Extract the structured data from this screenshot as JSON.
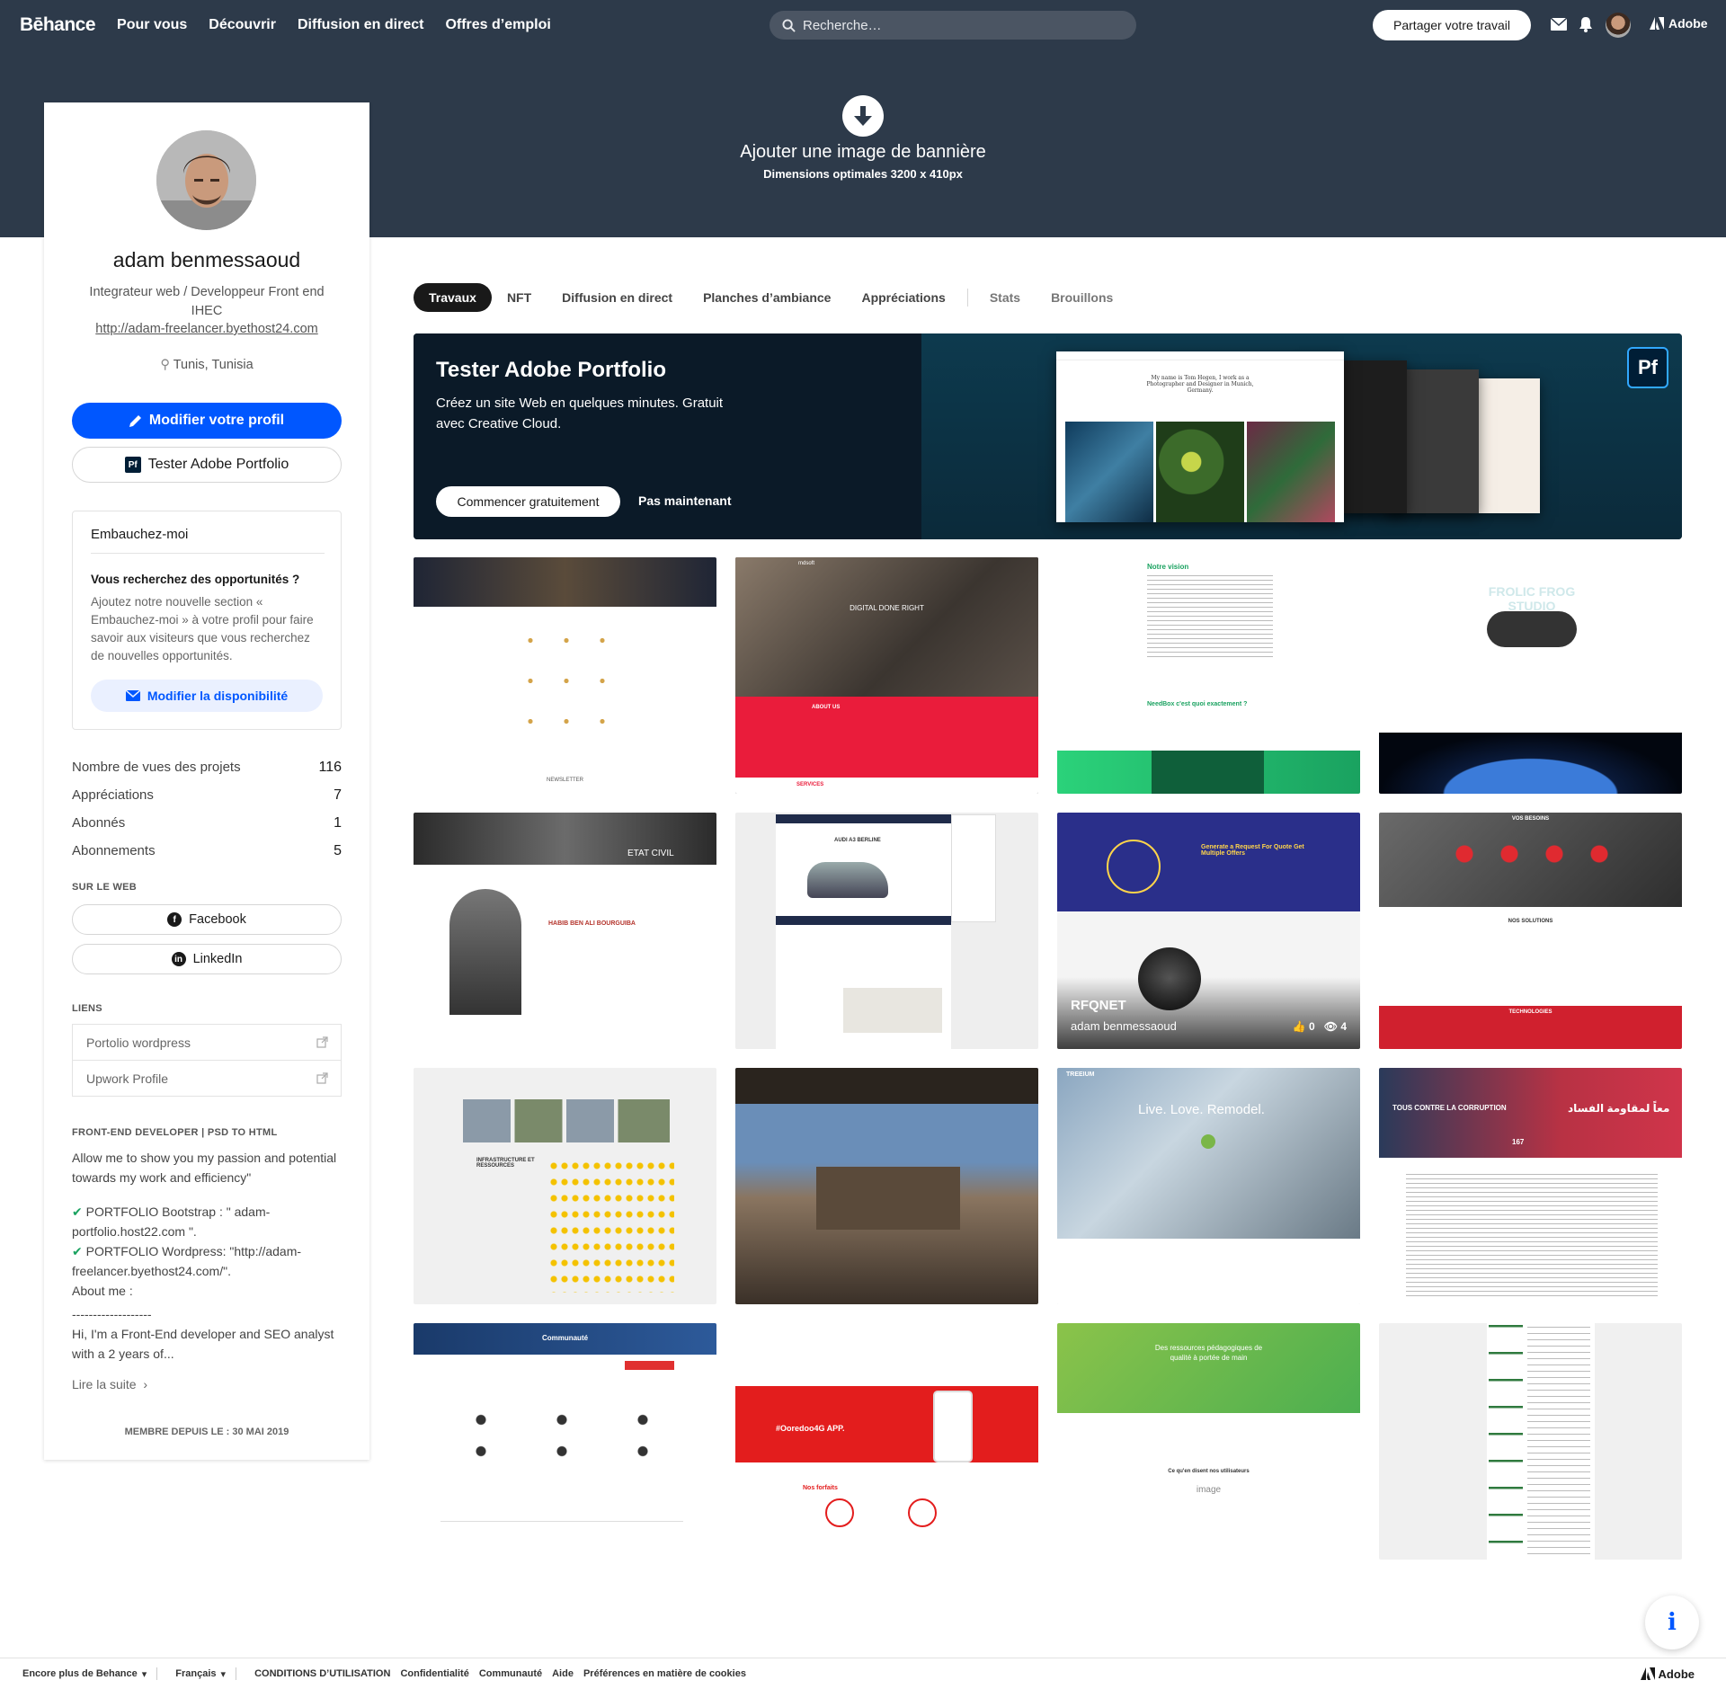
{
  "nav": {
    "logo": "Bēhance",
    "links": [
      "Pour vous",
      "Découvrir",
      "Diffusion en direct",
      "Offres d’emploi"
    ],
    "search_placeholder": "Recherche…",
    "share_label": "Partager votre travail",
    "adobe_label": "Adobe"
  },
  "banner": {
    "title": "Ajouter une image de bannière",
    "subtitle": "Dimensions optimales 3200 x 410px"
  },
  "profile": {
    "name": "adam benmessaoud",
    "title": "Integrateur web / Developpeur Front end IHEC",
    "website": "http://adam-freelancer.byethost24.com",
    "location": "Tunis, Tunisia",
    "edit_label": "Modifier votre profil",
    "portfolio_label": "Tester Adobe Portfolio",
    "hire": {
      "title": "Embauchez-moi",
      "question": "Vous recherchez des opportunités ?",
      "description": "Ajoutez notre nouvelle section « Embauchez-moi » à votre profil pour faire savoir aux visiteurs que vous recherchez de nouvelles opportunités.",
      "button": "Modifier la disponibilité"
    },
    "stats": [
      {
        "label": "Nombre de vues des projets",
        "value": "116"
      },
      {
        "label": "Appréciations",
        "value": "7"
      },
      {
        "label": "Abonnés",
        "value": "1"
      },
      {
        "label": "Abonnements",
        "value": "5"
      }
    ],
    "web_label": "SUR LE WEB",
    "social": [
      "Facebook",
      "LinkedIn"
    ],
    "links_label": "LIENS",
    "links": [
      "Portolio wordpress",
      "Upwork Profile"
    ],
    "about_label": "FRONT-END DEVELOPER | PSD TO HTML",
    "about_intro": "Allow me to show you my passion and potential towards my work and efficiency\"",
    "about_p1": "PORTFOLIO Bootstrap : \" adam-portfolio.host22.com \".",
    "about_p2": "PORTFOLIO Wordpress: \"http://adam-freelancer.byethost24.com/\".",
    "about_me": "About me :",
    "about_dash": "-------------------",
    "about_bio": "Hi, I'm a Front-End developer and SEO analyst with a 2 years of...",
    "read_more": "Lire la suite",
    "member_since": "MEMBRE DEPUIS LE : 30 MAI 2019"
  },
  "tabs": [
    "Travaux",
    "NFT",
    "Diffusion en direct",
    "Planches d’ambiance",
    "Appréciations",
    "Stats",
    "Brouillons"
  ],
  "promo": {
    "title": "Tester Adobe Portfolio",
    "description": "Créez un site Web en quelques minutes. Gratuit avec Creative Cloud.",
    "start_label": "Commencer gratuitement",
    "later_label": "Pas maintenant",
    "badge": "Pf",
    "mock_heading": "My name is Tom Hegen, I work as a Photographer and Designer in Munich, Germany."
  },
  "featured_project": {
    "title": "RFQNET",
    "owner": "adam benmessaoud",
    "likes": "0",
    "views": "4"
  },
  "thumb_texts": {
    "mdsoft": "mdsoft",
    "digital": "DIGITAL DONE RIGHT",
    "about": "ABOUT US",
    "services": "SERVICES",
    "vision": "Notre vision",
    "needbox": "NeedBox c'est quoi exactement ?",
    "frolic": "FROLIC FROG STUDIO",
    "etat": "ETAT CIVIL",
    "habib": "HABIB BEN ALI BOURGUIBA",
    "audi": "AUDI A3 BERLINE",
    "rfq_head": "Generate a Request For Quote Get Multiple Offers",
    "vos_besoins": "VOS BESOINS",
    "nos_solutions": "NOS SOLUTIONS",
    "techno": "TECHNOLOGIES",
    "infra": "INFRASTRUCTURE ET RESSOURCES",
    "treeium": "TREEIUM",
    "live": "Live. Love. Remodel.",
    "corruption": "TOUS CONTRE LA CORRUPTION",
    "arabic": "معاً لمقاومة الفساد",
    "count": "167",
    "communaute": "Communauté",
    "ooredoo": "#Ooredoo4G APP.",
    "forfaits": "Nos forfaits",
    "ressources": "Des ressources pédagogiques de qualité à portée de main",
    "disent": "Ce qu'en disent nos utilisateurs",
    "image": "image"
  },
  "footer": {
    "more": "Encore plus de Behance",
    "lang": "Français",
    "links": [
      "CONDITIONS D’UTILISATION",
      "Confidentialité",
      "Communauté",
      "Aide",
      "Préférences en matière de cookies"
    ],
    "adobe": "Adobe"
  },
  "colors": {
    "nav_bg": "#2d3a4a",
    "primary": "#0057ff",
    "promo_bg": "#0b1a28"
  }
}
